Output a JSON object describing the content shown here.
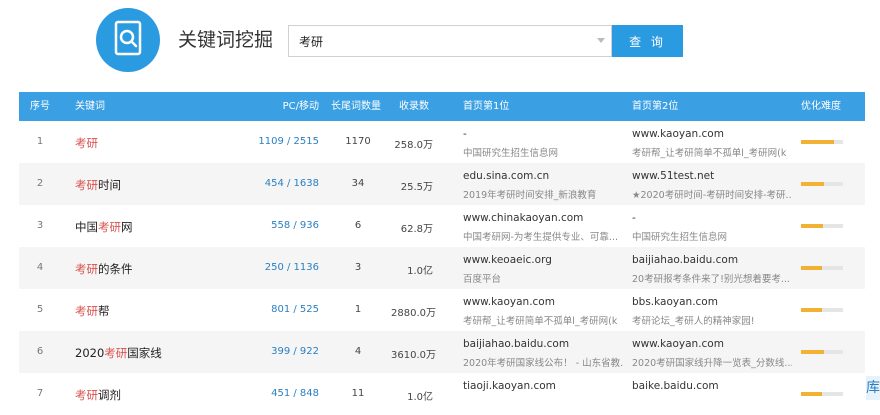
{
  "header": {
    "title": "关键词挖掘",
    "search_value": "考研",
    "search_button": "查 询",
    "logo_icon": "magnifier-document-icon"
  },
  "colors": {
    "accent": "#2a9be0",
    "highlight": "#d9534f",
    "difficulty": "#f2b134"
  },
  "table": {
    "headers": {
      "index": "序号",
      "keyword": "关键词",
      "pc_mobile": "PC/移动",
      "longtail": "长尾词数量",
      "index_count": "收录数",
      "site1": "首页第1位",
      "site2": "首页第2位",
      "difficulty": "优化难度"
    },
    "rows": [
      {
        "idx": "1",
        "kw_pre": "",
        "kw_hl": "考研",
        "kw_post": "",
        "pc": "1109 / 2515",
        "longtail": "1170",
        "count": "258.0万",
        "s1_domain": "-",
        "s1_title": "中国研究生招生信息网",
        "s2_domain": "www.kaoyan.com",
        "s2_title": "考研帮_让考研简单不孤单l_考研网(k",
        "difficulty": 0.78
      },
      {
        "idx": "2",
        "kw_pre": "",
        "kw_hl": "考研",
        "kw_post": "时间",
        "pc": "454 / 1638",
        "longtail": "34",
        "count": "25.5万",
        "s1_domain": "edu.sina.com.cn",
        "s1_title": "2019年考研时间安排_新浪教育",
        "s2_domain": "www.51test.net",
        "s2_title": "★2020考研时间-考研时间安排-考研...",
        "difficulty": 0.55
      },
      {
        "idx": "3",
        "kw_pre": "中国",
        "kw_hl": "考研",
        "kw_post": "网",
        "pc": "558 / 936",
        "longtail": "6",
        "count": "62.8万",
        "s1_domain": "www.chinakaoyan.com",
        "s1_title": "中国考研网-为考生提供专业、可靠...",
        "s2_domain": "-",
        "s2_title": "中国研究生招生信息网",
        "difficulty": 0.52
      },
      {
        "idx": "4",
        "kw_pre": "",
        "kw_hl": "考研",
        "kw_post": "的条件",
        "pc": "250 / 1136",
        "longtail": "3",
        "count": "1.0亿",
        "s1_domain": "www.keoaeic.org",
        "s1_title": "百度平台",
        "s2_domain": "baijiahao.baidu.com",
        "s2_title": "20考研报考条件来了!别光想着要考...",
        "difficulty": 0.5
      },
      {
        "idx": "5",
        "kw_pre": "",
        "kw_hl": "考研",
        "kw_post": "帮",
        "pc": "801 / 525",
        "longtail": "1",
        "count": "2880.0万",
        "s1_domain": "www.kaoyan.com",
        "s1_title": "考研帮_让考研简单不孤单l_考研网(k",
        "s2_domain": "bbs.kaoyan.com",
        "s2_title": "考研论坛_考研人的精神家园!",
        "difficulty": 0.5
      },
      {
        "idx": "6",
        "kw_pre": "2020",
        "kw_hl": "考研",
        "kw_post": "国家线",
        "pc": "399 / 922",
        "longtail": "4",
        "count": "3610.0万",
        "s1_domain": "baijiahao.baidu.com",
        "s1_title": "2020年考研国家线公布！ - 山东省教...",
        "s2_domain": "www.kaoyan.com",
        "s2_title": "2020考研国家线升降一览表_分数线...",
        "difficulty": 0.55
      },
      {
        "idx": "7",
        "kw_pre": "",
        "kw_hl": "考研",
        "kw_post": "调剂",
        "pc": "451 / 848",
        "longtail": "11",
        "count": "1.0亿",
        "s1_domain": "tiaoji.kaoyan.com",
        "s1_title": "",
        "s2_domain": "baike.baidu.com",
        "s2_title": "",
        "difficulty": 0.5
      }
    ]
  }
}
